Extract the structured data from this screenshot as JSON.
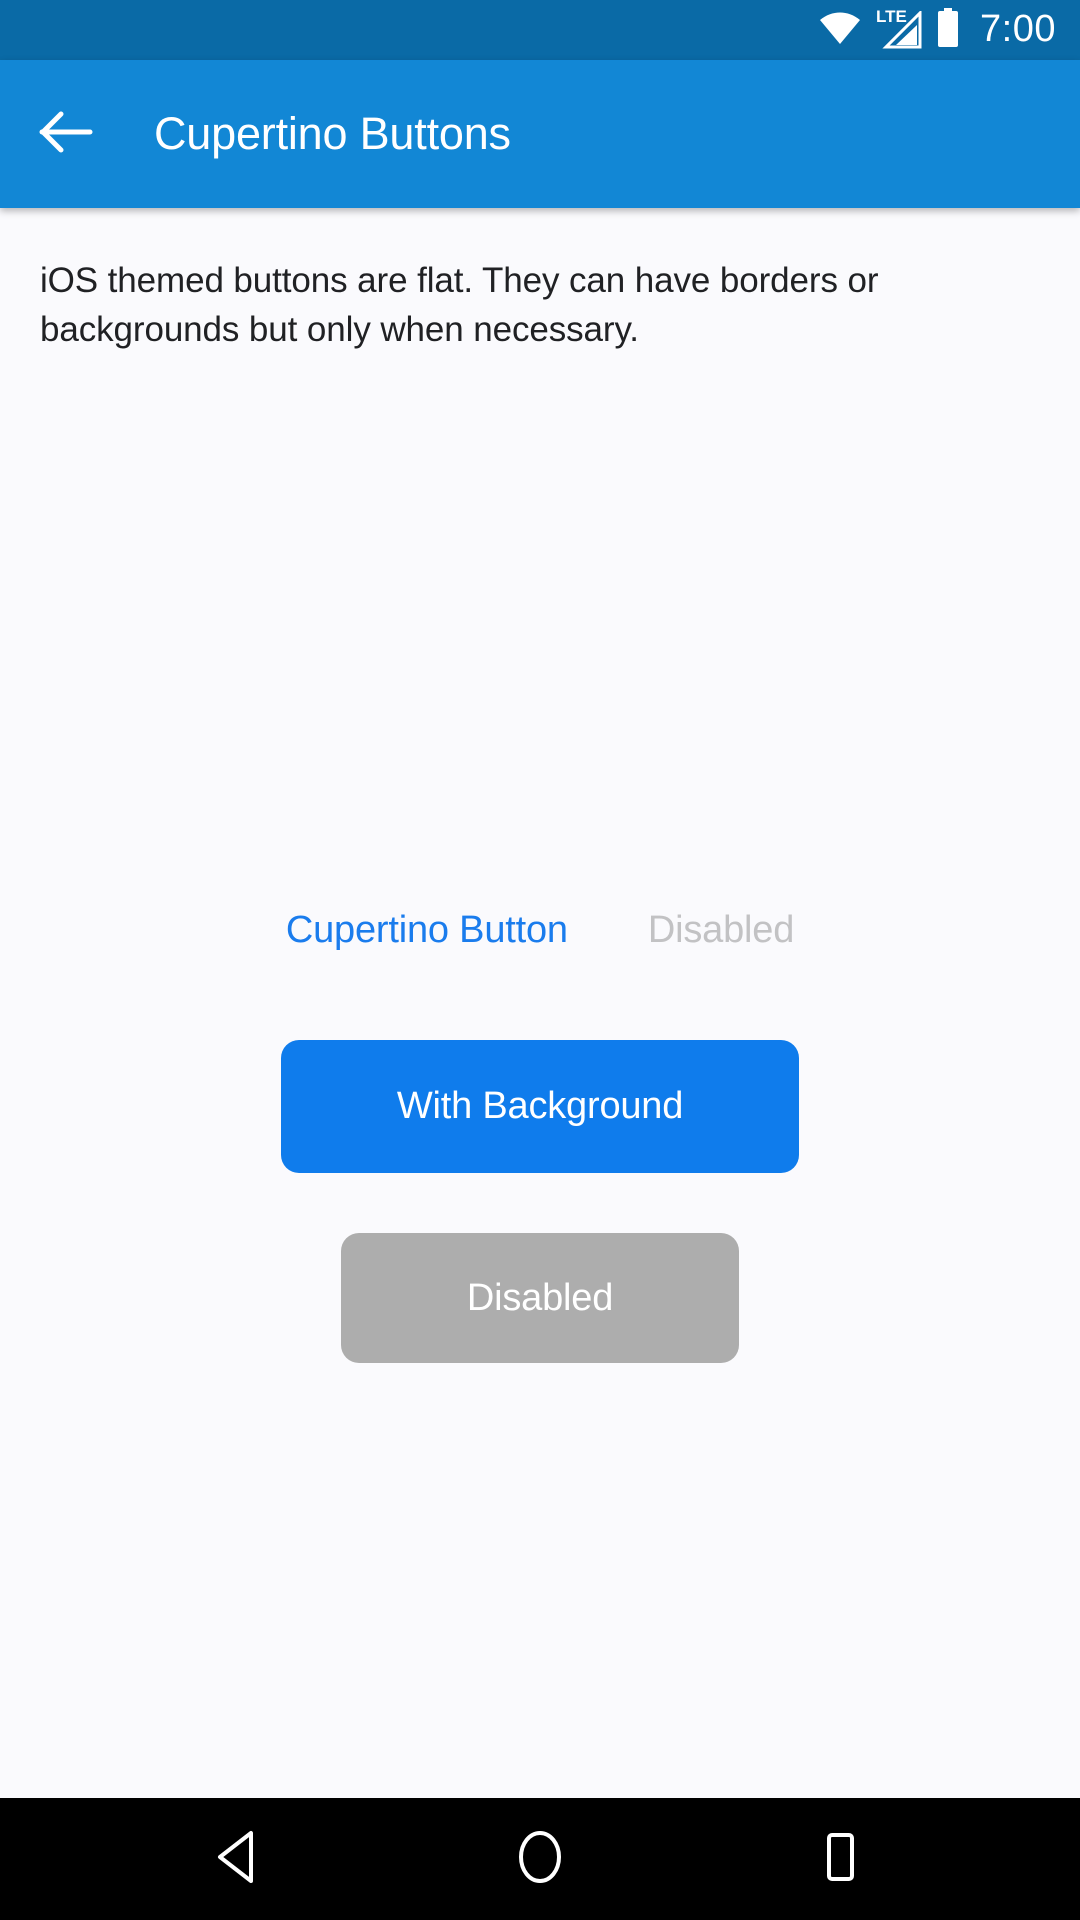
{
  "status_bar": {
    "wifi_icon": "wifi-icon",
    "network_label": "LTE",
    "signal_icon": "signal-bars-icon",
    "battery_icon": "battery-full-icon",
    "time": "7:00",
    "background_color": "#0a6aa6"
  },
  "app_bar": {
    "back_icon": "arrow-left-icon",
    "title": "Cupertino Buttons",
    "background_color": "#1287d5",
    "text_color": "#ffffff"
  },
  "main": {
    "description": "iOS themed buttons are flat. They can have borders or backgrounds but only when necessary.",
    "text_buttons": [
      {
        "label": "Cupertino Button",
        "state": "enabled",
        "color": "#1a7ced"
      },
      {
        "label": "Disabled",
        "state": "disabled",
        "color": "#c2c2c4"
      }
    ],
    "filled_buttons": [
      {
        "label": "With Background",
        "state": "enabled",
        "color": "#0f7cec"
      },
      {
        "label": "Disabled",
        "state": "disabled",
        "color": "#adadad"
      }
    ],
    "background_color": "#fafafd"
  },
  "nav_bar": {
    "background_color": "#000000",
    "buttons": [
      {
        "name": "back",
        "icon": "triangle-back-icon"
      },
      {
        "name": "home",
        "icon": "circle-home-icon"
      },
      {
        "name": "recents",
        "icon": "square-recents-icon"
      }
    ]
  }
}
